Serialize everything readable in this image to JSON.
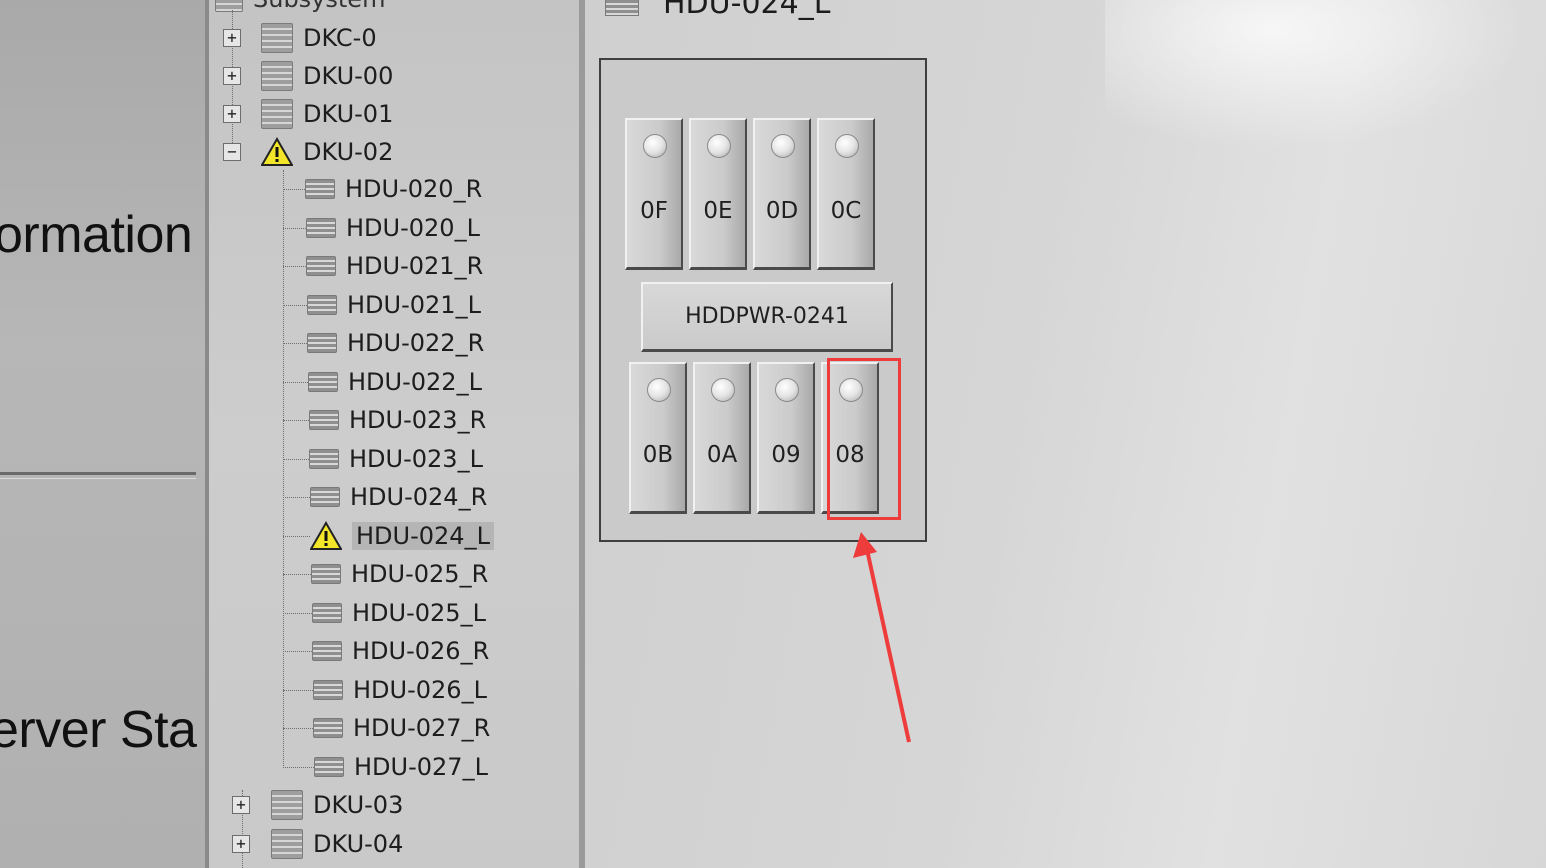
{
  "left_panel": {
    "heading_top": "ormation",
    "heading_bottom": "erver Sta"
  },
  "tree": {
    "root_label": "Subsystem",
    "nodes": [
      {
        "label": "DKC-0",
        "expander": "+",
        "icon": "disk-cabinet-icon"
      },
      {
        "label": "DKU-00",
        "expander": "+",
        "icon": "disk-cabinet-icon"
      },
      {
        "label": "DKU-01",
        "expander": "+",
        "icon": "disk-cabinet-icon"
      },
      {
        "label": "DKU-02",
        "expander": "−",
        "icon": "warning-icon"
      }
    ],
    "children": [
      {
        "label": "HDU-020_R",
        "icon": "hdu-icon"
      },
      {
        "label": "HDU-020_L",
        "icon": "hdu-icon"
      },
      {
        "label": "HDU-021_R",
        "icon": "hdu-icon"
      },
      {
        "label": "HDU-021_L",
        "icon": "hdu-icon"
      },
      {
        "label": "HDU-022_R",
        "icon": "hdu-icon"
      },
      {
        "label": "HDU-022_L",
        "icon": "hdu-icon"
      },
      {
        "label": "HDU-023_R",
        "icon": "hdu-icon"
      },
      {
        "label": "HDU-023_L",
        "icon": "hdu-icon"
      },
      {
        "label": "HDU-024_R",
        "icon": "hdu-icon"
      },
      {
        "label": "HDU-024_L",
        "icon": "warning-icon",
        "selected": true
      },
      {
        "label": "HDU-025_R",
        "icon": "hdu-icon"
      },
      {
        "label": "HDU-025_L",
        "icon": "hdu-icon"
      },
      {
        "label": "HDU-026_R",
        "icon": "hdu-icon"
      },
      {
        "label": "HDU-026_L",
        "icon": "hdu-icon"
      },
      {
        "label": "HDU-027_R",
        "icon": "hdu-icon"
      },
      {
        "label": "HDU-027_L",
        "icon": "hdu-icon"
      }
    ],
    "after_nodes": [
      {
        "label": "DKU-03",
        "expander": "+",
        "icon": "disk-cabinet-icon"
      },
      {
        "label": "DKU-04",
        "expander": "+",
        "icon": "disk-cabinet-icon"
      }
    ]
  },
  "detail": {
    "title": "HDU-024_L",
    "top_slots": [
      "0F",
      "0E",
      "0D",
      "0C"
    ],
    "power_supply": "HDDPWR-0241",
    "bottom_slots": [
      "0B",
      "0A",
      "09",
      "08"
    ],
    "highlighted_slot": "08",
    "annotation_color": "#ee3b3b"
  }
}
